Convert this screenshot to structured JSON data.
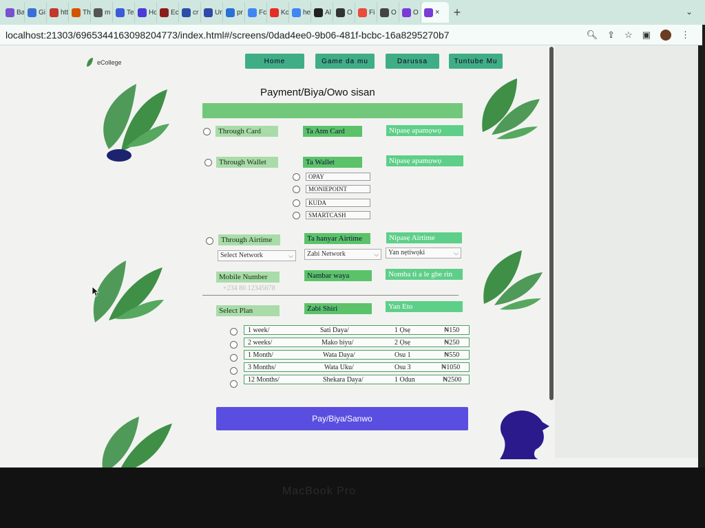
{
  "browser": {
    "tabs": [
      "Ba",
      "Gi",
      "htt",
      "Th",
      "m",
      "Te",
      "Hc",
      "Ec",
      "cr",
      "Ur",
      "pr",
      "Fc",
      "Kc",
      "he",
      "Al",
      "O",
      "Fi",
      "O",
      "O"
    ],
    "active_tab_close": "×",
    "new_tab": "+",
    "tab_menu": "⌄",
    "url": "localhost:21303/6965344163098204773/index.html#/screens/0dad4ee0-9b06-481f-bcbc-16a8295270b7",
    "icons": [
      "zoom-icon",
      "share-icon",
      "star-icon",
      "sidepanel-icon",
      "profile-avatar",
      "menu-icon"
    ]
  },
  "logo": {
    "text": "eCollege"
  },
  "nav": {
    "items": [
      "Home",
      "Game da mu",
      "Darussa",
      "Tuntube Mu"
    ]
  },
  "page": {
    "title": "Payment/Biya/Owo sisan"
  },
  "payment": {
    "card": {
      "en": "Through Card",
      "ha": "Ta Atm Card",
      "yo": "Nipasẹ apamọwọ"
    },
    "wallet": {
      "en": "Through Wallet",
      "ha": "Ta Wallet",
      "yo": "Nipasẹ apamọwọ"
    },
    "wallet_options": [
      "OPAY",
      "MONIEPOINT",
      "KUDA",
      "SMARTCASH"
    ],
    "airtime": {
      "en": "Through Airtime",
      "ha": "Ta hanyar Airtime",
      "yo": "Nipasẹ Airtime"
    },
    "network_selects": [
      "Select Network",
      "Zabi Network",
      "Yan nẹtiwọki"
    ],
    "mobile": {
      "en": "Mobile Number",
      "ha": "Nambar waya",
      "yo": "Nomba ti a le gbe rin",
      "placeholder": "+234 80 12345678"
    },
    "plan": {
      "en": "Select Plan",
      "ha": "Zabi Shiri",
      "yo": "Yan Eto"
    },
    "plans": [
      {
        "en": "1 week/",
        "ha": "Sati Daya/",
        "yo": "1 Ọsẹ",
        "price": "₦150"
      },
      {
        "en": "2 weeks/",
        "ha": "Mako biyu/",
        "yo": "2 Ọsẹ",
        "price": "₦250"
      },
      {
        "en": "1 Month/",
        "ha": "Wata Daya/",
        "yo": "Osu 1",
        "price": "₦550"
      },
      {
        "en": "3 Months/",
        "ha": "Wata Uku/",
        "yo": "Osu 3",
        "price": "₦1050"
      },
      {
        "en": "12 Months/",
        "ha": "Shekara Daya/",
        "yo": "1 Odun",
        "price": "₦2500"
      }
    ],
    "pay_button": "Pay/Biya/Sanwo"
  },
  "laptop": {
    "brand": "MacBook Pro"
  },
  "colors": {
    "nav_bg": "#3fae86",
    "pay_button": "#5a4ee0",
    "leaf_green": "#3f8f46",
    "mascot": "#2a1a8c"
  }
}
